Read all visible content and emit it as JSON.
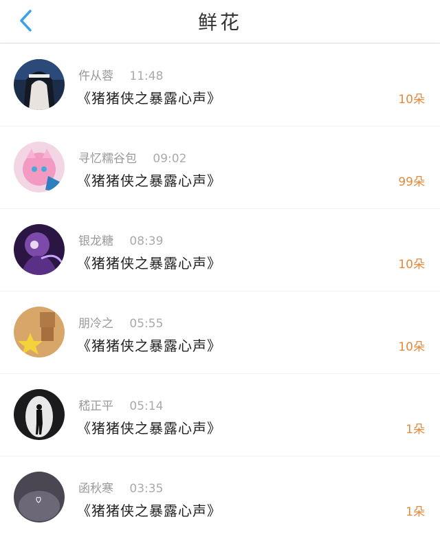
{
  "header": {
    "title": "鲜花",
    "back_icon": "chevron-left-icon",
    "accent": "#3aa0e8"
  },
  "count_color": "#e38a3c",
  "items": [
    {
      "name": "仵从蓉",
      "time": "11:48",
      "message": "《猪猪侠之暴露心声》",
      "count": "10朵"
    },
    {
      "name": "寻忆糯谷包",
      "time": "09:02",
      "message": "《猪猪侠之暴露心声》",
      "count": "99朵"
    },
    {
      "name": "银龙糖",
      "time": "08:39",
      "message": "《猪猪侠之暴露心声》",
      "count": "10朵"
    },
    {
      "name": "朋冷之",
      "time": "05:55",
      "message": "《猪猪侠之暴露心声》",
      "count": "10朵"
    },
    {
      "name": "嵇正平",
      "time": "05:14",
      "message": "《猪猪侠之暴露心声》",
      "count": "1朵"
    },
    {
      "name": "函秋寒",
      "time": "03:35",
      "message": "《猪猪侠之暴露心声》",
      "count": "1朵"
    }
  ]
}
